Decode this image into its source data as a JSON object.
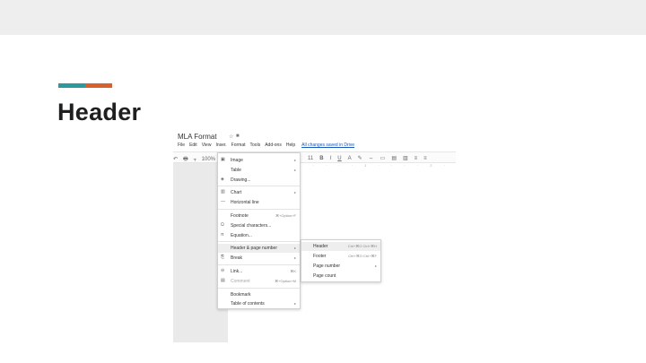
{
  "slide": {
    "title": "Header",
    "accent_colors": [
      "#2a9a9a",
      "#d95f2b"
    ],
    "band_color": "#eeeeee"
  },
  "doc": {
    "title": "MLA Format",
    "title_icons": [
      "star-icon",
      "folder-icon"
    ],
    "menus": [
      "File",
      "Edit",
      "View",
      "Inser.",
      "Format",
      "Tools",
      "Add-ons",
      "Help"
    ],
    "saved_status": "All changes saved in Drive"
  },
  "toolbar": {
    "left": [
      "↶",
      "🖶",
      "ᚁ",
      "100%"
    ],
    "font_size": "11",
    "buttons": [
      "B",
      "I",
      "U",
      "A",
      "✎",
      "⇔",
      "▭",
      "▤",
      "▥",
      "≡",
      "≡"
    ],
    "ruler": "1 · · · · 1 · · · · 2 · · · · 3 · · · · 4 · · · · 5"
  },
  "insert_menu": {
    "items": [
      {
        "icon": "▣",
        "icon_name": "image-icon",
        "label": "Image",
        "right": "▸",
        "highlight": false,
        "dim": false
      },
      {
        "icon": "",
        "icon_name": "",
        "label": "Table",
        "right": "▸",
        "highlight": false,
        "dim": false
      },
      {
        "icon": "◈",
        "icon_name": "drawing-icon",
        "label": "Drawing...",
        "right": "",
        "highlight": false,
        "dim": false
      },
      {
        "icon": "▥",
        "icon_name": "chart-icon",
        "label": "Chart",
        "right": "▸",
        "highlight": false,
        "dim": false
      },
      {
        "icon": "—",
        "icon_name": "horizontal-line-icon",
        "label": "Horizontal line",
        "right": "",
        "highlight": false,
        "dim": false
      },
      {
        "icon": "",
        "icon_name": "",
        "label": "Footnote",
        "right": "⌘+Option+F",
        "highlight": false,
        "dim": false
      },
      {
        "icon": "Ω",
        "icon_name": "special-characters-icon",
        "label": "Special characters...",
        "right": "",
        "highlight": false,
        "dim": false
      },
      {
        "icon": "π",
        "icon_name": "equation-icon",
        "label": "Equation...",
        "right": "",
        "highlight": false,
        "dim": false
      },
      {
        "icon": "",
        "icon_name": "",
        "label": "Header & page number",
        "right": "▸",
        "highlight": true,
        "dim": false
      },
      {
        "icon": "⎘",
        "icon_name": "break-icon",
        "label": "Break",
        "right": "▸",
        "highlight": false,
        "dim": false
      },
      {
        "icon": "⊖",
        "icon_name": "link-icon",
        "label": "Link...",
        "right": "⌘K",
        "highlight": false,
        "dim": false
      },
      {
        "icon": "▤",
        "icon_name": "comment-icon",
        "label": "Comment",
        "right": "⌘+Option+M",
        "highlight": false,
        "dim": true
      },
      {
        "icon": "",
        "icon_name": "",
        "label": "Bookmark",
        "right": "",
        "highlight": false,
        "dim": false
      },
      {
        "icon": "",
        "icon_name": "",
        "label": "Table of contents",
        "right": "▸",
        "highlight": false,
        "dim": false
      }
    ]
  },
  "header_submenu": {
    "items": [
      {
        "label": "Header",
        "right": "Ctrl+⌘O Ctrl+⌘H",
        "highlight": true
      },
      {
        "label": "Footer",
        "right": "Ctrl+⌘O Ctrl+⌘F",
        "highlight": false
      },
      {
        "label": "Page number",
        "right": "▸",
        "highlight": false
      },
      {
        "label": "Page count",
        "right": "",
        "highlight": false
      }
    ]
  }
}
